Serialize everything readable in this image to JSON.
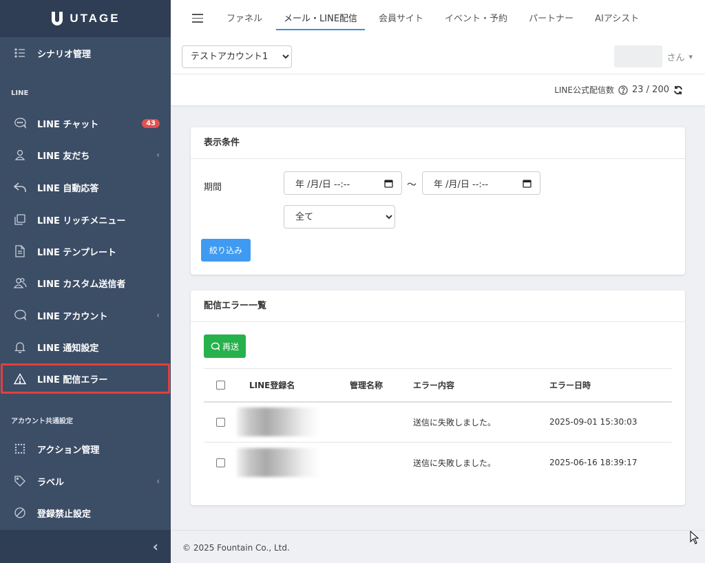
{
  "brand": {
    "name": "UTAGE"
  },
  "sidebar": {
    "items": [
      {
        "key": "scenario",
        "label": "シナリオ管理",
        "icon": "list-icon"
      },
      {
        "key": "line-chat",
        "label": "LINE チャット",
        "icon": "chat-icon",
        "badge": "43"
      },
      {
        "key": "line-friends",
        "label": "LINE 友だち",
        "icon": "user-icon",
        "chevron": "‹"
      },
      {
        "key": "line-auto-reply",
        "label": "LINE 自動応答",
        "icon": "reply-icon"
      },
      {
        "key": "line-rich-menu",
        "label": "LINE リッチメニュー",
        "icon": "copy-icon"
      },
      {
        "key": "line-template",
        "label": "LINE テンプレート",
        "icon": "document-icon"
      },
      {
        "key": "line-custom-sender",
        "label": "LINE カスタム送信者",
        "icon": "users-icon"
      },
      {
        "key": "line-account",
        "label": "LINE アカウント",
        "icon": "chat-bubble-icon",
        "chevron": "‹"
      },
      {
        "key": "line-notify",
        "label": "LINE 通知設定",
        "icon": "bell-icon"
      },
      {
        "key": "line-delivery-error",
        "label": "LINE 配信エラー",
        "icon": "warning-icon"
      },
      {
        "key": "action",
        "label": "アクション管理",
        "icon": "grid-icon"
      },
      {
        "key": "label",
        "label": "ラベル",
        "icon": "tag-icon",
        "chevron": "‹"
      },
      {
        "key": "block",
        "label": "登録禁止設定",
        "icon": "ban-icon"
      }
    ],
    "sections": {
      "line": "LINE",
      "common": "アカウント共通設定"
    },
    "collapse": "‹"
  },
  "topnav": {
    "tabs": [
      "ファネル",
      "メール・LINE配信",
      "会員サイト",
      "イベント・予約",
      "パートナー",
      "AIアシスト"
    ],
    "active_tab": "メール・LINE配信"
  },
  "account_selector": {
    "value": "テストアカウント1"
  },
  "user": {
    "suffix": "さん",
    "caret": "▾"
  },
  "line_counter": {
    "label": "LINE公式配信数",
    "value": "23 / 200"
  },
  "filter_card": {
    "title": "表示条件",
    "period_label": "期間",
    "date_from_placeholder": "年 /月/日 --:--",
    "date_to_placeholder": "年 /月/日 --:--",
    "separator": "～",
    "type_select_value": "全て",
    "submit_label": "絞り込み"
  },
  "error_card": {
    "title": "配信エラー一覧",
    "resend_label": "再送",
    "columns": [
      "LINE登録名",
      "管理名称",
      "エラー内容",
      "エラー日時"
    ],
    "rows": [
      {
        "admin_name": "",
        "error": "送信に失敗しました。",
        "datetime": "2025-09-01 15:30:03"
      },
      {
        "admin_name": "",
        "error": "送信に失敗しました。",
        "datetime": "2025-06-16 18:39:17"
      }
    ]
  },
  "footer": {
    "copyright": "© 2025 Fountain Co., Ltd."
  },
  "colors": {
    "sidebar_bg": "#3c4d66",
    "brand_bg": "#2f3e54",
    "accent_blue": "#3e9bf1",
    "success_green": "#27b14c",
    "badge_red": "#e3504d",
    "active_outline": "#e4403d"
  }
}
